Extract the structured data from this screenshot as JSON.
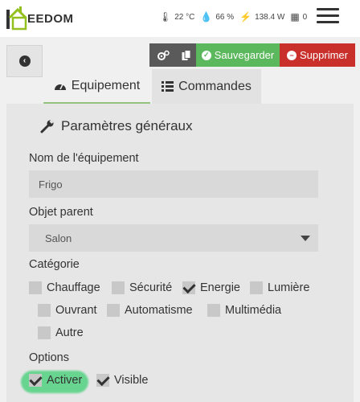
{
  "header": {
    "logo_text": "EEDOM",
    "temperature": "22 °C",
    "humidity": "66 %",
    "power": "138.4 W",
    "alerts": "0"
  },
  "toolbar": {
    "save_label": "Sauvegarder",
    "delete_label": "Supprimer"
  },
  "tabs": [
    {
      "label": "Equipement"
    },
    {
      "label": "Commandes"
    }
  ],
  "section": {
    "title": "Paramètres généraux"
  },
  "form": {
    "name_label": "Nom de l'équipement",
    "name_value": "Frigo",
    "parent_label": "Objet parent",
    "parent_value": "Salon",
    "category_label": "Catégorie",
    "categories": [
      {
        "label": "Chauffage",
        "checked": false
      },
      {
        "label": "Sécurité",
        "checked": false
      },
      {
        "label": "Energie",
        "checked": true
      },
      {
        "label": "Lumière",
        "checked": false
      },
      {
        "label": "Ouvrant",
        "checked": false
      },
      {
        "label": "Automatisme",
        "checked": false
      },
      {
        "label": "Multimédia",
        "checked": false
      },
      {
        "label": "Autre",
        "checked": false
      }
    ],
    "options_label": "Options",
    "options": [
      {
        "label": "Activer",
        "checked": true
      },
      {
        "label": "Visible",
        "checked": true
      }
    ]
  },
  "colors": {
    "save_green": "#5cb85c",
    "delete_red": "#c9302c",
    "highlight": "#52d181"
  }
}
